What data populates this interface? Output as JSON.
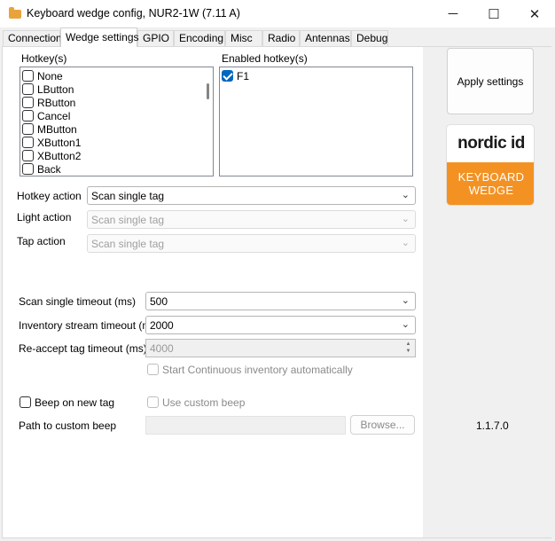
{
  "window": {
    "title": "Keyboard wedge config, NUR2-1W  (7.11 A)",
    "minimize": "─",
    "maximize": "☐",
    "close": "✕"
  },
  "tabs": [
    "Connection",
    "Wedge settings",
    "GPIO",
    "Encoding",
    "Misc",
    "Radio",
    "Antennas",
    "Debug"
  ],
  "active_tab": "Wedge settings",
  "hotkeys": {
    "label": "Hotkey(s)",
    "items": [
      {
        "label": "None",
        "checked": false
      },
      {
        "label": "LButton",
        "checked": false
      },
      {
        "label": "RButton",
        "checked": false
      },
      {
        "label": "Cancel",
        "checked": false
      },
      {
        "label": "MButton",
        "checked": false
      },
      {
        "label": "XButton1",
        "checked": false
      },
      {
        "label": "XButton2",
        "checked": false
      },
      {
        "label": "Back",
        "checked": false
      }
    ]
  },
  "enabled_hotkeys": {
    "label": "Enabled hotkey(s)",
    "items": [
      {
        "label": "F1",
        "checked": true
      }
    ]
  },
  "hotkey_action": {
    "label": "Hotkey action",
    "value": "Scan single tag"
  },
  "light_action": {
    "label": "Light action",
    "value": "Scan single tag"
  },
  "tap_action": {
    "label": "Tap action",
    "value": "Scan single tag"
  },
  "scan_single_timeout": {
    "label": "Scan single timeout (ms)",
    "value": "500"
  },
  "inventory_stream_timeout": {
    "label": "Inventory stream timeout (ms)",
    "value": "2000"
  },
  "reaccept_timeout": {
    "label": "Re-accept tag timeout (ms)",
    "value": "4000"
  },
  "start_continuous": {
    "label": "Start Continuous inventory automatically",
    "checked": false
  },
  "beep_on_new_tag": {
    "label": "Beep on new tag",
    "checked": false
  },
  "use_custom_beep": {
    "label": "Use custom beep",
    "checked": false
  },
  "custom_beep_path": {
    "label": "Path to custom beep",
    "value": ""
  },
  "browse_button": "Browse...",
  "apply_button": "Apply settings",
  "logo": {
    "brand": "nordic id",
    "line1": "KEYBOARD",
    "line2": "WEDGE",
    "accent": "#f39223"
  },
  "version": "1.1.7.0"
}
